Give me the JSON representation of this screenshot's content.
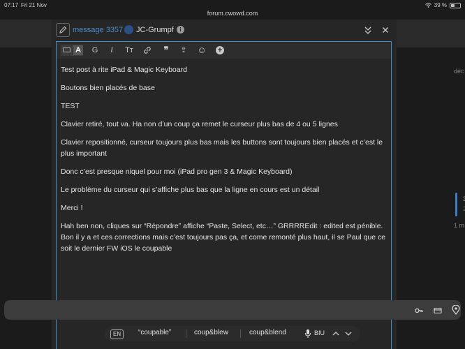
{
  "statusbar": {
    "time": "07:17",
    "date": "Fri 21 Nov",
    "battery": "39 %"
  },
  "browser": {
    "url": "forum.cwowd.com"
  },
  "background": {
    "right_label": "déc",
    "right_item_1": "3",
    "right_item_2": "2",
    "right_item_3": "1 m"
  },
  "composer": {
    "reply_to": "message 3357",
    "username": "JC-Grumpf",
    "info_glyph": "i",
    "toolbar": {
      "toggle_label": "A",
      "bold": "G",
      "italic": "I",
      "heading": "Tт",
      "quote": "❞",
      "upload": "⇪",
      "emoji": "☺",
      "more": "+"
    },
    "body": {
      "p1": "Test post à rite iPad & Magic Keyboard",
      "p2": "Boutons bien placés de base",
      "p3": "TEST",
      "p4": "Clavier retiré, tout va. Ha non d’un coup ça remet le curseur plus bas de 4 ou 5 lignes",
      "p5": "Clavier repositionné, curseur toujours plus bas mais les buttons sont toujours bien placés et c’est le plus important",
      "p6": "Donc c’est presque niquel pour moi (iPad pro gen 3 & Magic Keyboard)",
      "p7": "Le problème du curseur qui s’affiche plus bas que la ligne en cours est un détail",
      "p8": "Merci !",
      "p9": "Hah ben non, cliques sur “Répondre” affiche “Paste, Select, etc…” GRRRREdit : edited est pénible. Bon il y a et ces corrections mais c’est toujours pas ça, et come remonté plus haut, il se Paul que ce soit le dernier FW iOS le coupable"
    }
  },
  "quicktype": {
    "lang": "EN",
    "s1": "“coupable”",
    "s2": "coup&blew",
    "s3": "coup&blend",
    "format": "BIU"
  },
  "icons": {
    "pencil": "pencil-icon",
    "collapse": "chevrons-down-icon",
    "close": "close-icon",
    "key": "key-icon",
    "card": "card-icon",
    "pin": "location-pin-icon",
    "mic": "microphone-icon"
  },
  "colors": {
    "accent": "#3f8fcc",
    "link": "#4f8bc9",
    "background": "#1b1b1b",
    "panel": "#262626"
  }
}
